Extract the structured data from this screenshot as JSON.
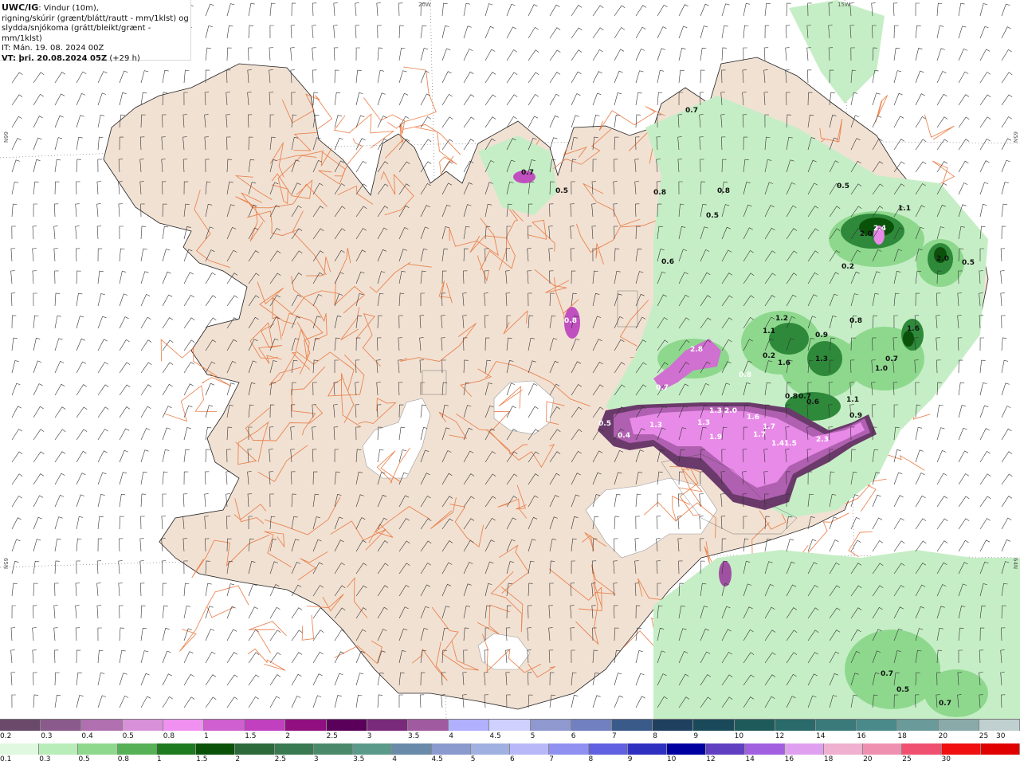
{
  "header": {
    "title": "UWC/IG",
    "line1_rest": ": Vindur (10m),",
    "line2": "rigning/skúrir (grænt/blátt/rautt - mm/1klst) og",
    "line3": "slydda/snjókoma (grátt/bleikt/grænt - mm/1klst)",
    "it": "IT: Mán. 19. 08. 2024 00Z",
    "vt_bold": "VT: þri. 20.08.2024 05Z",
    "vt_rest": " (+29 h)"
  },
  "grid_labels": {
    "top_20w": "20W",
    "top_15w": "15W",
    "left_66n": "66N",
    "left_65n": "65N",
    "right_65n": "65N",
    "right_64n": "64N"
  },
  "value_labels": [
    {
      "text": "0.7"
    },
    {
      "text": "0.8"
    },
    {
      "text": "0.8"
    },
    {
      "text": "0.5"
    },
    {
      "text": "0.5"
    },
    {
      "text": "0.6"
    },
    {
      "text": "1.1"
    },
    {
      "text": "2.4"
    },
    {
      "text": "2.0"
    },
    {
      "text": "0.2"
    },
    {
      "text": "2.0"
    },
    {
      "text": "0.5"
    },
    {
      "text": "0.8"
    },
    {
      "text": "1.6"
    },
    {
      "text": "1.2"
    },
    {
      "text": "1.1"
    },
    {
      "text": "0.9"
    },
    {
      "text": "0.2"
    },
    {
      "text": "1.6"
    },
    {
      "text": "1.3"
    },
    {
      "text": "1.0"
    },
    {
      "text": "0.7"
    },
    {
      "text": "2.8"
    },
    {
      "text": "0.7"
    },
    {
      "text": "0.8"
    },
    {
      "text": "0.8"
    },
    {
      "text": "0.7"
    },
    {
      "text": "0.6"
    },
    {
      "text": "1.1"
    },
    {
      "text": "0.9"
    },
    {
      "text": "0.5"
    },
    {
      "text": "0.4"
    },
    {
      "text": "1.3"
    },
    {
      "text": "1.3"
    },
    {
      "text": "2.0"
    },
    {
      "text": "1.3"
    },
    {
      "text": "1.9"
    },
    {
      "text": "1.6"
    },
    {
      "text": "1.7"
    },
    {
      "text": "1.7"
    },
    {
      "text": "1.41.5"
    },
    {
      "text": "2.3"
    },
    {
      "text": "0.8"
    },
    {
      "text": "0.5"
    },
    {
      "text": "0.7"
    },
    {
      "text": "0.5"
    },
    {
      "text": "0.7"
    },
    {
      "text": "0.7"
    }
  ],
  "legend_top": {
    "ticks": [
      "0.2",
      "0.3",
      "0.4",
      "0.5",
      "0.8",
      "1",
      "1.5",
      "2",
      "2.5",
      "3",
      "3.5",
      "4",
      "4.5",
      "5",
      "6",
      "7",
      "8",
      "9",
      "10",
      "12",
      "14",
      "16",
      "18",
      "20",
      "25",
      "30"
    ],
    "colors": [
      "#6a4a6a",
      "#8a5a8a",
      "#b070b0",
      "#d890d8",
      "#f090f0",
      "#d060d0",
      "#c040c0",
      "#901080",
      "#5a005a",
      "#7a2a7a",
      "#a05aa0",
      "#b0b0ff",
      "#d0d0ff",
      "#9098d0",
      "#7080c0",
      "#3a5a8a",
      "#204060",
      "#1a4a5a",
      "#1f5a5a",
      "#2a6a6a",
      "#3a7a7a",
      "#4a8a8a",
      "#6a9a9a",
      "#8aaaaa",
      "#c0d0d0"
    ]
  },
  "legend_bottom": {
    "ticks": [
      "0.1",
      "0.3",
      "0.5",
      "0.8",
      "1",
      "1.5",
      "2",
      "2.5",
      "3",
      "3.5",
      "4",
      "4.5",
      "5",
      "6",
      "7",
      "8",
      "9",
      "10",
      "12",
      "14",
      "16",
      "18",
      "20",
      "25",
      "30"
    ],
    "colors": [
      "#e0f8e0",
      "#b8ecb8",
      "#8ed88e",
      "#56b056",
      "#1e7a1e",
      "#0a520a",
      "#2c6a3c",
      "#3a7a52",
      "#4a8a6a",
      "#5a9a8a",
      "#6a8aaa",
      "#8a9acc",
      "#a0b0e0",
      "#b8b8f8",
      "#9090f0",
      "#6060e0",
      "#3030c0",
      "#0000a0",
      "#6040c0",
      "#a060e0",
      "#e0a0f0",
      "#f0b0d0",
      "#f090b0",
      "#f05070",
      "#f01010",
      "#e00000"
    ]
  }
}
